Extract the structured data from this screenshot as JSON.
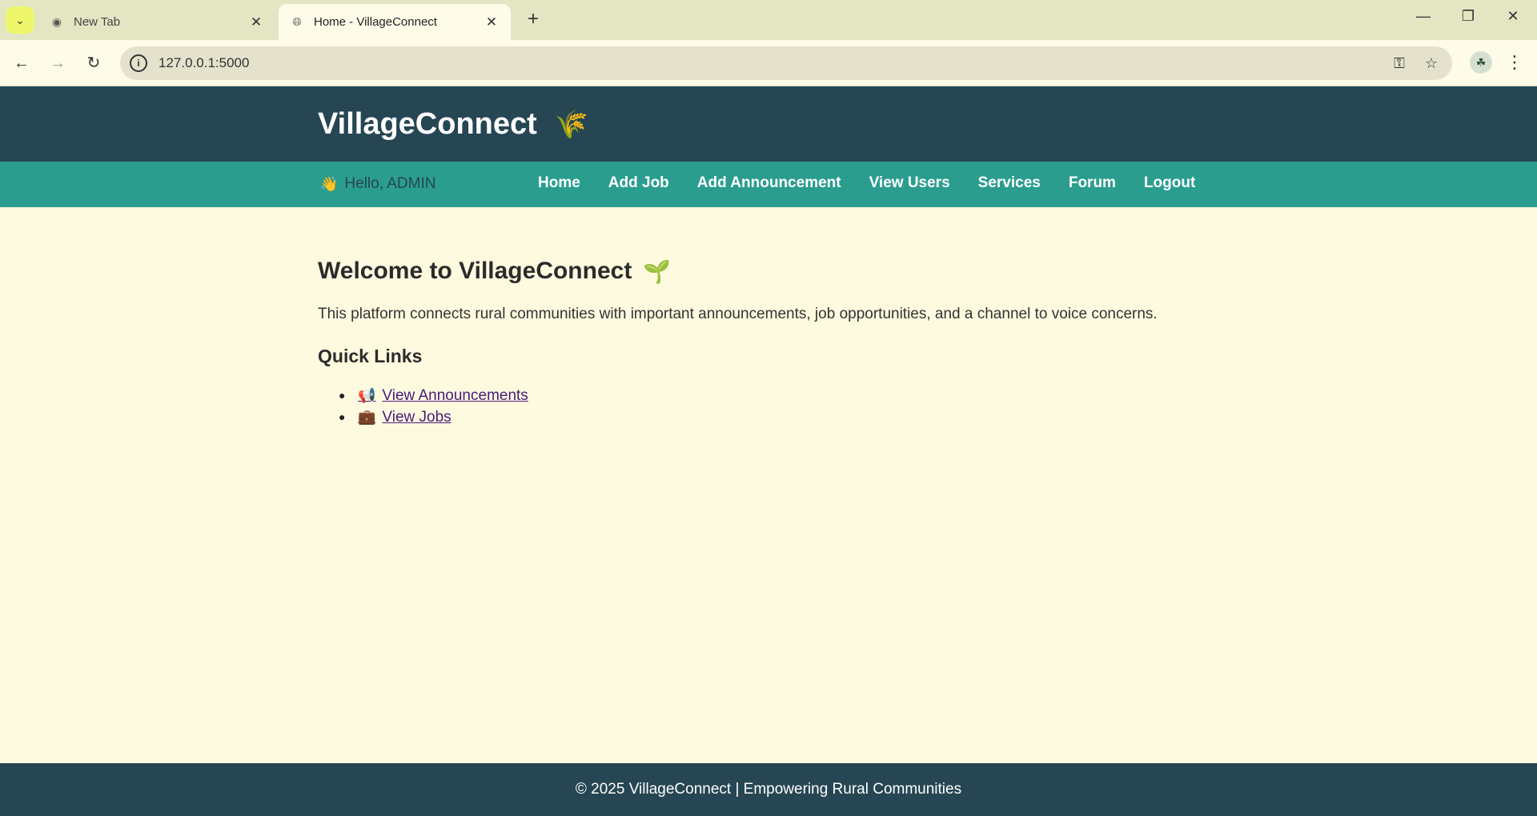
{
  "browser": {
    "tabs": [
      {
        "title": "New Tab",
        "active": false,
        "icon": "chrome-icon"
      },
      {
        "title": "Home - VillageConnect",
        "active": true,
        "icon": "globe-icon"
      }
    ],
    "url": "127.0.0.1:5000"
  },
  "site": {
    "brand": "VillageConnect",
    "brand_icon": "🌾",
    "greeting_icon": "👋",
    "greeting": "Hello, ADMIN",
    "nav": [
      "Home",
      "Add Job",
      "Add Announcement",
      "View Users",
      "Services",
      "Forum",
      "Logout"
    ]
  },
  "main": {
    "heading": "Welcome to VillageConnect",
    "heading_icon": "🌱",
    "intro": "This platform connects rural communities with important announcements, job opportunities, and a channel to voice concerns.",
    "quick_links_heading": "Quick Links",
    "quick_links": [
      {
        "icon": "📢",
        "label": "View Announcements"
      },
      {
        "icon": "💼",
        "label": "View Jobs"
      }
    ]
  },
  "footer": {
    "text": "© 2025 VillageConnect | Empowering Rural Communities"
  },
  "colors": {
    "header_bg": "#264653",
    "nav_bg": "#2a9d8f",
    "page_bg": "#fefae0",
    "link": "#4a1a78"
  }
}
